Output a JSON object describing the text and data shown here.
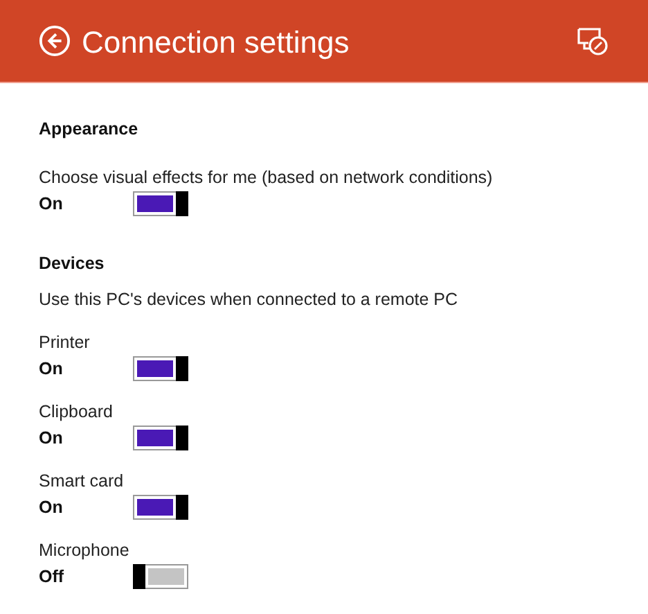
{
  "header": {
    "title": "Connection settings"
  },
  "sections": [
    {
      "heading": "Appearance",
      "settings": [
        {
          "label": "Choose visual effects for me (based on network conditions)",
          "kind": "description",
          "state": "On",
          "on": true
        }
      ]
    },
    {
      "heading": "Devices",
      "description": "Use this PC's devices when connected to a remote PC",
      "settings": [
        {
          "label": "Printer",
          "kind": "plain",
          "state": "On",
          "on": true
        },
        {
          "label": "Clipboard",
          "kind": "plain",
          "state": "On",
          "on": true
        },
        {
          "label": "Smart card",
          "kind": "plain",
          "state": "On",
          "on": true
        },
        {
          "label": "Microphone",
          "kind": "plain",
          "state": "Off",
          "on": false
        }
      ]
    }
  ]
}
